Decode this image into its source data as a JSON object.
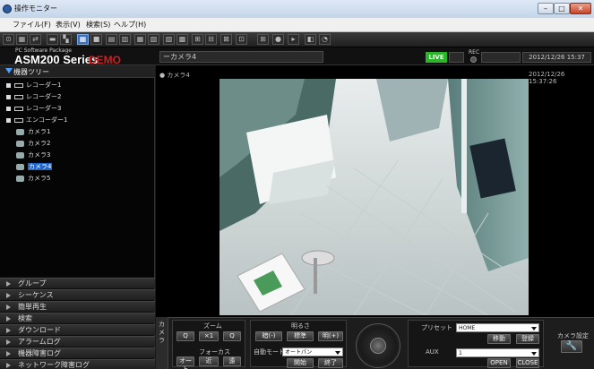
{
  "window": {
    "title": "操作モニター",
    "min": "–",
    "max": "□",
    "close": "✕"
  },
  "menu": [
    {
      "label": "ファイル(F)"
    },
    {
      "label": "表示(V)"
    },
    {
      "label": "検索(S)"
    },
    {
      "label": "ヘルプ(H)"
    }
  ],
  "header": {
    "package": "PC Software Package",
    "product": "ASM200 Series",
    "demo": "DEMO",
    "status": "ーカメラ4",
    "live": "LIVE",
    "rec": "REC",
    "datetime": "2012/12/26 15:37"
  },
  "tree": {
    "title": "機器ツリー",
    "items": [
      {
        "label": "レコーダー1"
      },
      {
        "label": "レコーダー2"
      },
      {
        "label": "レコーダー3"
      },
      {
        "label": "エンコーダー1"
      },
      {
        "label": "カメラ1"
      },
      {
        "label": "カメラ2"
      },
      {
        "label": "カメラ3"
      },
      {
        "label": "カメラ4"
      },
      {
        "label": "カメラ5"
      }
    ]
  },
  "panels": [
    {
      "label": "グループ"
    },
    {
      "label": "シーケンス"
    },
    {
      "label": "簡単再生"
    },
    {
      "label": "検索"
    },
    {
      "label": "ダウンロード"
    },
    {
      "label": "アラームログ"
    },
    {
      "label": "機器障害ログ"
    },
    {
      "label": "ネットワーク障害ログ"
    }
  ],
  "video": {
    "label": "カメラ4",
    "timestamp": "2012/12/26 15:37:26"
  },
  "controls": {
    "cam_tab": "カメラ",
    "zoom": {
      "label": "ズーム",
      "minus": "Q",
      "x1": "×1",
      "plus": "Q"
    },
    "focus": {
      "label": "フォーカス",
      "auto": "オート",
      "near": "近",
      "far": "遠"
    },
    "brightness": {
      "label": "明るさ",
      "dark": "暗(-)",
      "std": "標準",
      "bright": "明(+)"
    },
    "auto_mode": {
      "label": "自動モード",
      "value": "オートパン",
      "start": "開始",
      "stop": "終了"
    },
    "preset": {
      "label": "プリセット",
      "value": "HOME",
      "move": "移動",
      "register": "登録"
    },
    "aux": {
      "label": "AUX",
      "value": "1",
      "open": "OPEN",
      "close": "CLOSE"
    },
    "cam_settings": {
      "label": "カメラ設定"
    }
  }
}
